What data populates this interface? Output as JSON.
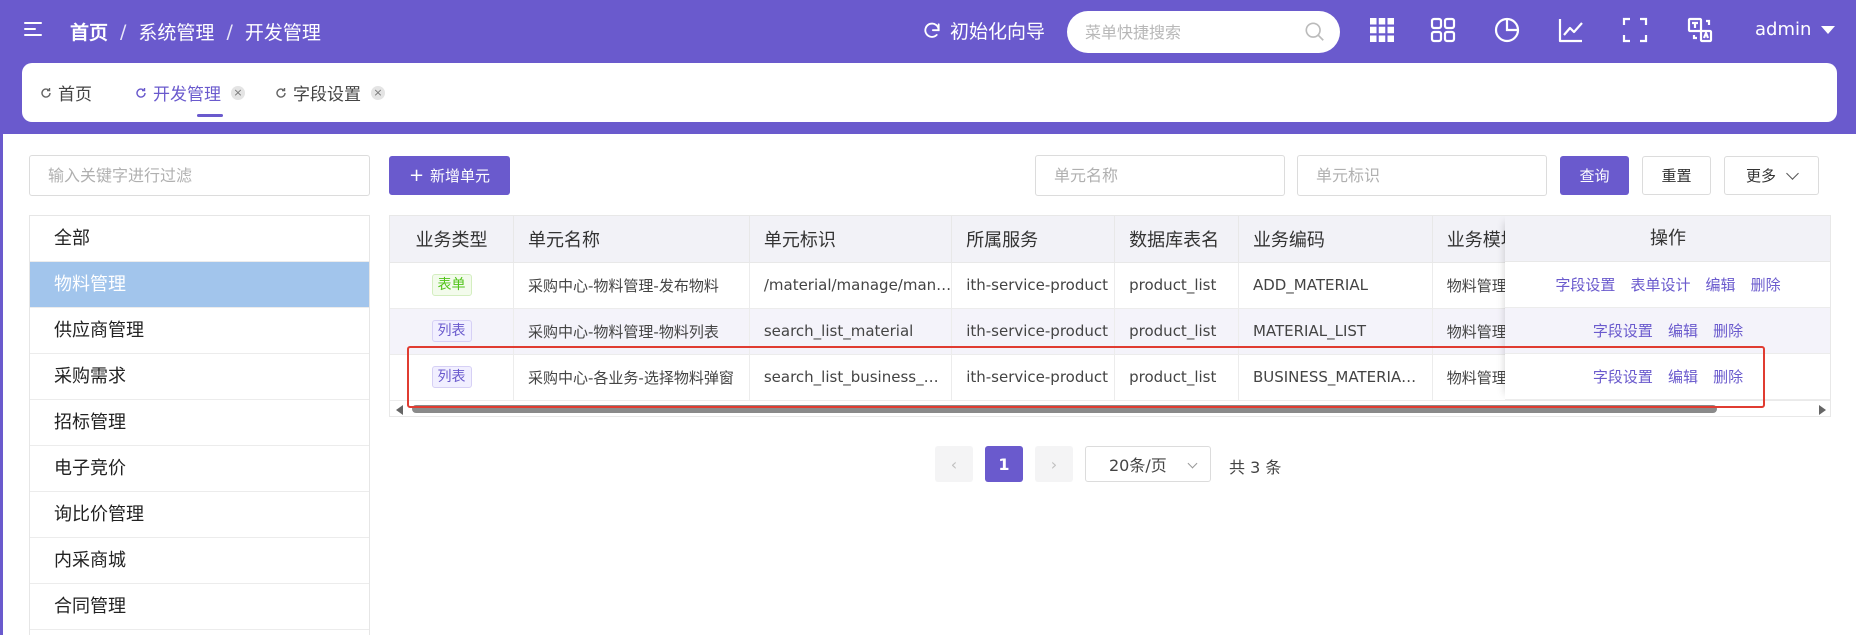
{
  "header": {
    "breadcrumb": [
      "首页",
      "系统管理",
      "开发管理"
    ],
    "init_guide": "初始化向导",
    "search_placeholder": "菜单快捷搜索",
    "user": "admin"
  },
  "tabs": [
    {
      "label": "首页"
    },
    {
      "label": "开发管理"
    },
    {
      "label": "字段设置"
    }
  ],
  "tab_close_glyph": "×",
  "sidebar": {
    "filter_placeholder": "输入关键字进行过滤",
    "items": [
      "全部",
      "物料管理",
      "供应商管理",
      "采购需求",
      "招标管理",
      "电子竞价",
      "询比价管理",
      "内采商城",
      "合同管理"
    ]
  },
  "toolbar": {
    "add_label": "新增单元",
    "unit_name_placeholder": "单元名称",
    "unit_id_placeholder": "单元标识",
    "query_label": "查询",
    "reset_label": "重置",
    "more_label": "更多"
  },
  "table": {
    "headers": [
      "业务类型",
      "单元名称",
      "单元标识",
      "所属服务",
      "数据库表名",
      "业务编码",
      "业务模块",
      "操作"
    ],
    "rows": [
      {
        "type": "表单",
        "name": "采购中心-物料管理-发布物料",
        "id": "/material/manage/man…",
        "service": "ith-service-product",
        "table": "product_list",
        "code": "ADD_MATERIAL",
        "module": "物料管理",
        "ops": [
          "字段设置",
          "表单设计",
          "编辑",
          "删除"
        ]
      },
      {
        "type": "列表",
        "name": "采购中心-物料管理-物料列表",
        "id": "search_list_material",
        "service": "ith-service-product",
        "table": "product_list",
        "code": "MATERIAL_LIST",
        "module": "物料管理",
        "ops": [
          "字段设置",
          "编辑",
          "删除"
        ]
      },
      {
        "type": "列表",
        "name": "采购中心-各业务-选择物料弹窗",
        "id": "search_list_business_…",
        "service": "ith-service-product",
        "table": "product_list",
        "code": "BUSINESS_MATERIA…",
        "module": "物料管理",
        "ops": [
          "字段设置",
          "编辑",
          "删除"
        ]
      }
    ]
  },
  "pagination": {
    "current_page": "1",
    "prev_glyph": "‹",
    "next_glyph": "›",
    "page_size": "20条/页",
    "total": "共 3 条"
  },
  "colors": {
    "accent": "#6a5acd",
    "selected_bg": "#a2c5ec",
    "highlight": "#e03c31"
  }
}
